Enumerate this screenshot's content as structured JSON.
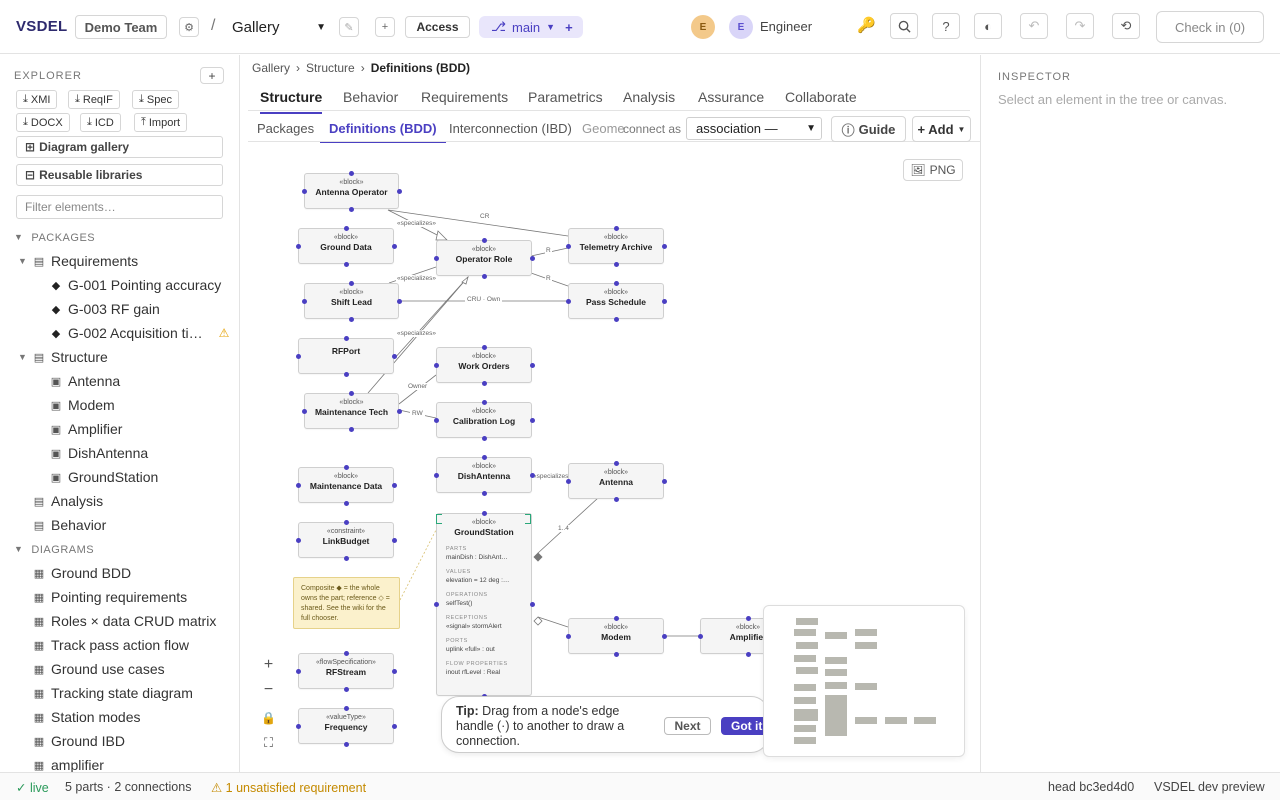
{
  "topbar": {
    "brand": "VSDEL",
    "team": "Demo Team",
    "settings_icon": "gear-icon",
    "separator": "/",
    "gallery_select": "Gallery",
    "access": "Access",
    "branch": "main",
    "branch_icon": "branch-icon",
    "avatar1": "E",
    "avatar2": "E",
    "user_role": "Engineer",
    "check_in": "Check in (0)",
    "accent": "#4a3fc2"
  },
  "sidebar": {
    "title": "EXPLORER",
    "chips": [
      "XMI",
      "ReqIF",
      "Spec",
      "DOCX",
      "ICD",
      "Import"
    ],
    "diagram_gallery": "Diagram gallery",
    "reusable_libraries": "Reusable libraries",
    "filter_placeholder": "Filter elements…",
    "packages_header": "PACKAGES",
    "packages": {
      "requirements": "Requirements",
      "req_items": [
        "G-001 Pointing accuracy",
        "G-003 RF gain",
        "G-002 Acquisition ti…"
      ],
      "structure": "Structure",
      "structure_items": [
        "Antenna",
        "Modem",
        "Amplifier",
        "DishAntenna",
        "GroundStation"
      ],
      "analysis": "Analysis",
      "behavior": "Behavior"
    },
    "diagrams_header": "DIAGRAMS",
    "diagrams": [
      "Ground BDD",
      "Pointing requirements",
      "Roles × data CRUD matrix",
      "Track pass action flow",
      "Ground use cases",
      "Tracking state diagram",
      "Station modes",
      "Ground IBD"
    ],
    "cut_off": "amplifier"
  },
  "breadcrumb": [
    "Gallery",
    "Structure",
    "Definitions (BDD)"
  ],
  "tabs": [
    "Structure",
    "Behavior",
    "Requirements",
    "Parametrics",
    "Analysis",
    "Assurance",
    "Collaborate"
  ],
  "subtabs": [
    "Packages",
    "Definitions (BDD)",
    "Interconnection (IBD)",
    "Geome"
  ],
  "connect_as": "connect as",
  "association": "association —",
  "guide": "Guide",
  "add": "+ Add",
  "png": "PNG",
  "diagram": {
    "stereo_block": "«block»",
    "stereo_constraint": "«constraint»",
    "stereo_flow": "«flowSpecification»",
    "stereo_value": "«valueType»",
    "nodes": {
      "antenna_operator": "Antenna Operator",
      "ground_data": "Ground Data",
      "operator_role": "Operator Role",
      "telemetry_archive": "Telemetry Archive",
      "shift_lead": "Shift Lead",
      "pass_schedule": "Pass Schedule",
      "rfport": "RFPort",
      "work_orders": "Work Orders",
      "maintenance_tech": "Maintenance Tech",
      "calibration_log": "Calibration Log",
      "maintenance_data": "Maintenance Data",
      "dishantenna": "DishAntenna",
      "antenna": "Antenna",
      "linkbudget": "LinkBudget",
      "groundstation": "GroundStation",
      "modem": "Modem",
      "amplifier": "Amplifier",
      "rfstream": "RFStream",
      "frequency": "Frequency"
    },
    "edge_labels": {
      "cr": "CR",
      "specializes": "«specializes»",
      "r": "R",
      "cru_own": "CRU · Own",
      "owner": "Owner",
      "rw": "RW",
      "multiplicity": "1..4"
    },
    "groundstation_sections": {
      "parts_h": "PARTS",
      "parts": "mainDish : DishAnt…",
      "values_h": "VALUES",
      "values": "elevation = 12 deg :…",
      "ops_h": "OPERATIONS",
      "ops": "selfTest()",
      "rec_h": "RECEPTIONS",
      "rec": "«signal» stormAlert",
      "ports_h": "PORTS",
      "ports": "uplink «full» : out",
      "flow_h": "FLOW PROPERTIES",
      "flow": "inout rfLevel : Real"
    },
    "note": "Composite ◆ = the whole owns the part; reference ◇ = shared. See the wiki for the full chooser."
  },
  "tip": {
    "bold": "Tip:",
    "text": " Drag from a node's edge handle (·) to another to draw a connection.",
    "next": "Next",
    "got_it": "Got it"
  },
  "inspector": {
    "title": "INSPECTOR",
    "hint": "Select an element in the tree or canvas."
  },
  "status": {
    "live": "✓ live",
    "summary": "5 parts · 2 connections",
    "unsatisfied": "⚠ 1 unsatisfied requirement",
    "head": "head bc3ed4d0",
    "product": "VSDEL dev preview"
  }
}
